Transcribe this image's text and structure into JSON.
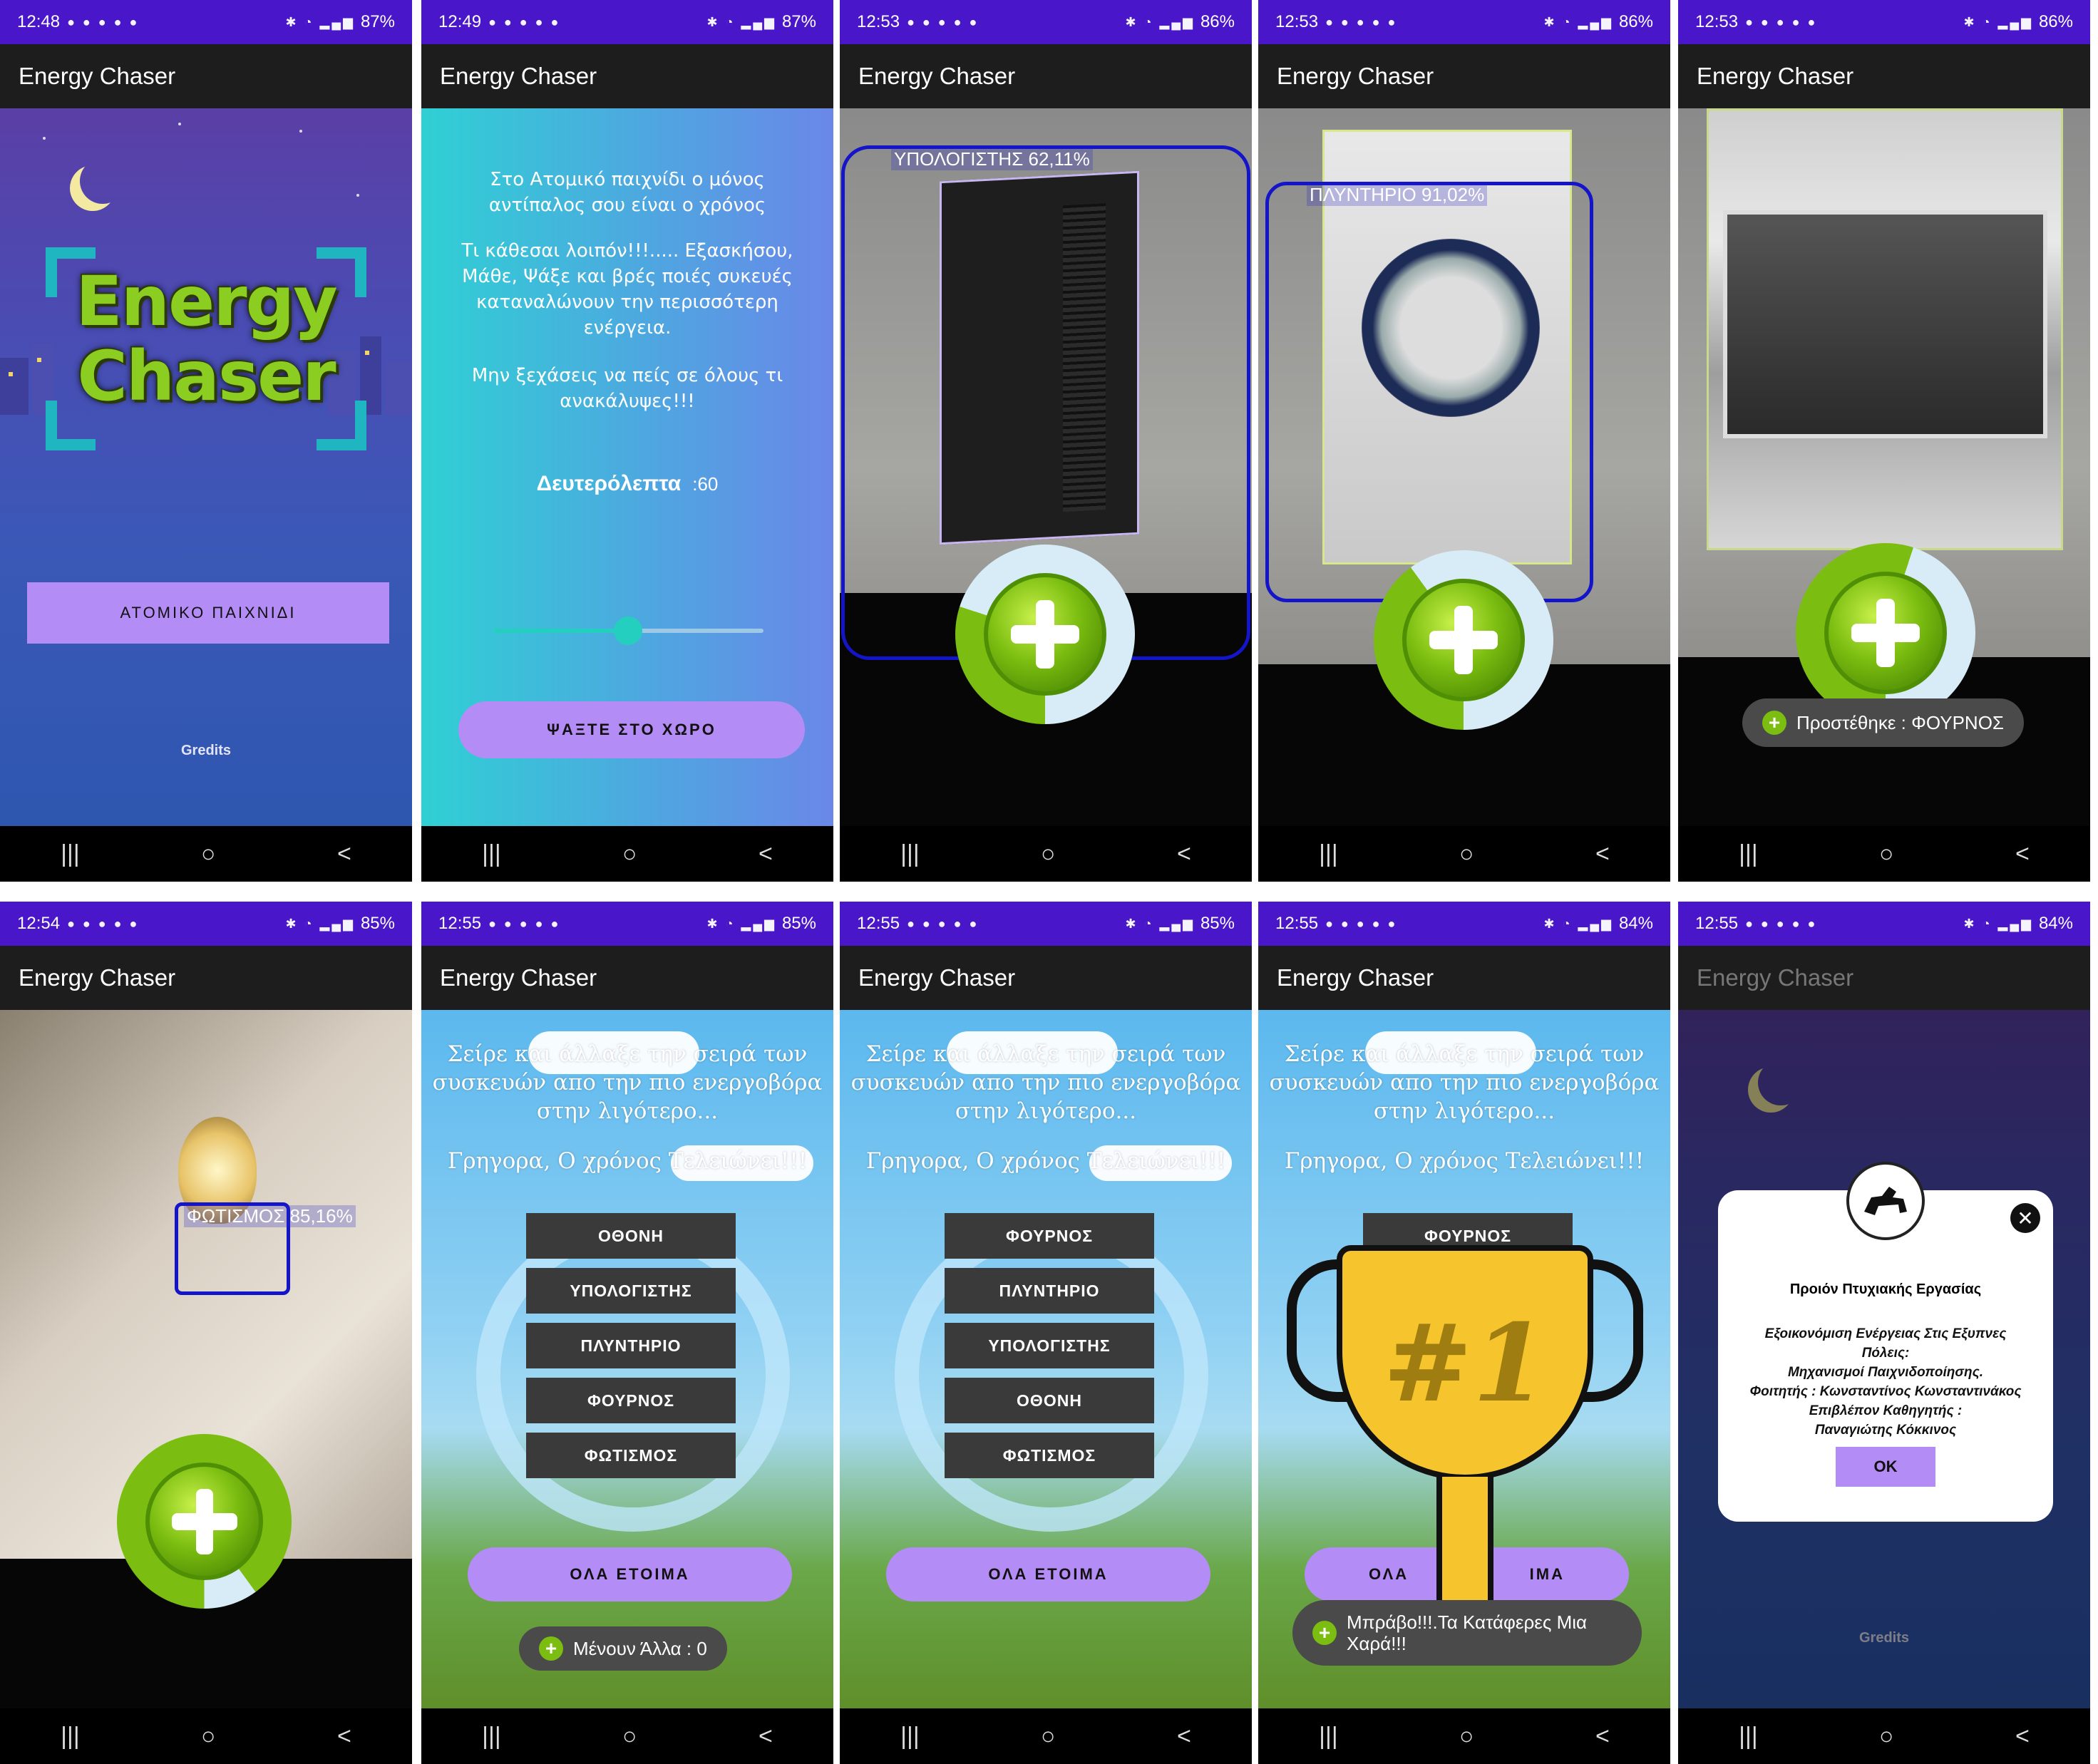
{
  "app_title": "Energy Chaser",
  "status": {
    "s1": {
      "time": "12:48",
      "battery": "87%"
    },
    "s2": {
      "time": "12:49",
      "battery": "87%"
    },
    "s3": {
      "time": "12:53",
      "battery": "86%"
    },
    "s4": {
      "time": "12:53",
      "battery": "86%"
    },
    "s5": {
      "time": "12:53",
      "battery": "86%"
    },
    "s6": {
      "time": "12:54",
      "battery": "85%"
    },
    "s7": {
      "time": "12:55",
      "battery": "85%"
    },
    "s8": {
      "time": "12:55",
      "battery": "85%"
    },
    "s9": {
      "time": "12:55",
      "battery": "84%"
    },
    "s10": {
      "time": "12:55",
      "battery": "84%"
    }
  },
  "nav": {
    "recents": "|||",
    "home": "○",
    "back": "<"
  },
  "start": {
    "logo_line1": "Energy",
    "logo_line2": "Chaser",
    "single_player_button": "ΑΤΟΜΙΚΟ ΠΑΙΧΝΙΔΙ",
    "credits_link": "Gredits"
  },
  "intro": {
    "p1": "Στο Ατομικό παιχνίδι ο μόνος αντίπαλος σου είναι ο χρόνος",
    "p2": "Τι κάθεσαι λοιπόν!!!..... Εξασκήσου, Μάθε, Ψάξε και βρές ποιές συκευές καταναλώνουν την περισσότερη ενέργεια.",
    "p3": "Μην ξεχάσεις να πείς σε όλους τι ανακάλυψες!!!",
    "timer_label": "Δευτερόλεπτα",
    "timer_value": ":60",
    "slider_value": 0.5,
    "search_button": "ΨΑΞΤΕ ΣΤΟ ΧΩΡΟ"
  },
  "detections": {
    "computer": "ΥΠΟΛΟΓΙΣΤΗΣ 62,11%",
    "washer": "ΠΛΥΝΤΗΡΙΟ 91,02%",
    "lighting": "ΦΩΤΙΣΜΟΣ 85,16%"
  },
  "progress": {
    "computer": 0.3,
    "washer": 0.4,
    "oven": 0.55,
    "lighting": 0.9
  },
  "toast_added": "Προστέθηκε : ΦΟΥΡΝΟΣ",
  "sort": {
    "instruction": "Σείρε και άλλαξε την σειρά των συσκευών απο την πιο ενεργοβόρα στην λιγότερο...",
    "hurry": "Γρηγορα, Ο χρόνος Τελειώνει!!!",
    "ready_button": "ΟΛΑ ΕΤΟΙΜΑ",
    "list_a": [
      "ΟΘΟΝΗ",
      "ΥΠΟΛΟΓΙΣΤΗΣ",
      "ΠΛΥΝΤΗΡΙΟ",
      "ΦΟΥΡΝΟΣ",
      "ΦΩΤΙΣΜΟΣ"
    ],
    "list_b": [
      "ΦΟΥΡΝΟΣ",
      "ΠΛΥΝΤΗΡΙΟ",
      "ΥΠΟΛΟΓΙΣΤΗΣ",
      "ΟΘΟΝΗ",
      "ΦΩΤΙΣΜΟΣ"
    ],
    "list_c_top": "ΦΟΥΡΝΟΣ",
    "ready_partial_left": "ΟΛΑ",
    "ready_partial_right": "ΙΜΑ",
    "remaining_toast": "Μένουν Άλλα : 0",
    "bravo_toast": "Μπράβο!!!.Τα Κατάφερες Μια Χαρά!!!",
    "trophy_text": "#1"
  },
  "credits_dialog": {
    "title": "Προιόν Πτυχιακής Εργασίας",
    "body_1": "Εξοικονόμιση Ενέργειας Στις Εξυπνες Πόλεις:",
    "body_2": "Μηχανισμοί Παιχνιδοποίησης.",
    "body_3": "Φοιτητής : Κωνσταντίνος Κωνσταντινάκος",
    "body_4": "Επιβλέπον Καθηγητής :",
    "body_5": "Παναγιώτης Κόκκινος",
    "ok_button": "OK",
    "close": "✕"
  },
  "colors": {
    "status_bar": "#4a16c9",
    "app_bar": "#1d1d1d",
    "accent_purple": "#b48cf5",
    "green": "#7bbd10",
    "detection_blue": "#1414c8"
  }
}
